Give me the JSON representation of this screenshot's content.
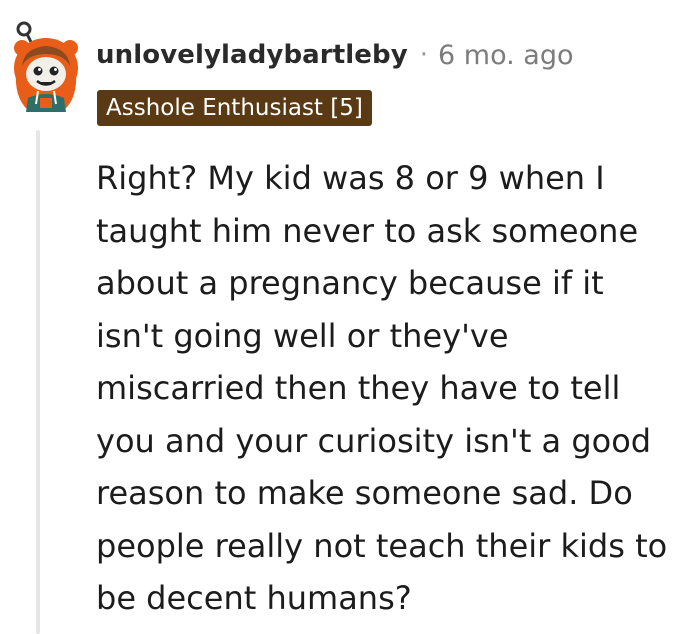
{
  "comment": {
    "username": "unlovelyladybartleby",
    "separator": "·",
    "timestamp": "6 mo. ago",
    "flair": "Asshole Enthusiast [5]",
    "body_lines": [
      "Right? My kid was 8 or 9 when I",
      "taught him never to ask someone",
      "about a pregnancy because if it",
      "isn't going well or they've",
      "miscarried then they have to tell",
      "you and your curiosity isn't a good",
      "reason to make someone sad. Do",
      "people really not teach their kids to",
      "be decent humans?"
    ]
  },
  "colors": {
    "flair_background": "#5a3a14",
    "flair_text": "#ffffff",
    "username": "#2a2a2a",
    "timestamp": "#7c7c7c",
    "body_text": "#1c1c1c",
    "thread_line": "#e6e6e6"
  },
  "icons": {
    "avatar": "snoo-avatar-orange-hood"
  }
}
